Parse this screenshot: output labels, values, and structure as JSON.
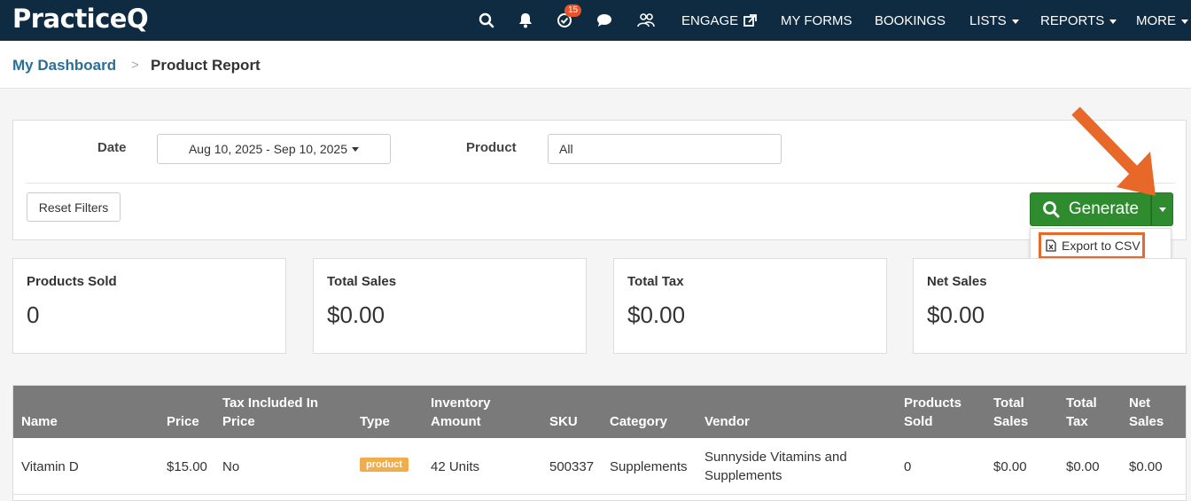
{
  "nav": {
    "logo": "PracticeQ",
    "badge_count": "15",
    "links": [
      "ENGAGE",
      "MY FORMS",
      "BOOKINGS",
      "LISTS",
      "REPORTS",
      "MORE"
    ]
  },
  "breadcrumb": {
    "home": "My Dashboard",
    "separator": ">",
    "current": "Product Report"
  },
  "filters": {
    "date_label": "Date",
    "date_value": "Aug 10, 2025 - Sep 10, 2025",
    "product_label": "Product",
    "product_value": "All",
    "reset_label": "Reset Filters",
    "generate_label": "Generate",
    "export_label": "Export to CSV"
  },
  "cards": [
    {
      "label": "Products Sold",
      "value": "0"
    },
    {
      "label": "Total Sales",
      "value": "$0.00"
    },
    {
      "label": "Total Tax",
      "value": "$0.00"
    },
    {
      "label": "Net Sales",
      "value": "$0.00"
    }
  ],
  "table": {
    "headers": {
      "name": "Name",
      "price": "Price",
      "tax_included_1": "Tax Included In",
      "tax_included_2": "Price",
      "type": "Type",
      "inventory_1": "Inventory",
      "inventory_2": "Amount",
      "sku": "SKU",
      "category": "Category",
      "vendor": "Vendor",
      "products_sold_1": "Products",
      "products_sold_2": "Sold",
      "total_sales_1": "Total",
      "total_sales_2": "Sales",
      "total_tax_1": "Total",
      "total_tax_2": "Tax",
      "net_sales_1": "Net",
      "net_sales_2": "Sales"
    },
    "rows": [
      {
        "name": "Vitamin D",
        "price": "$15.00",
        "tax_included": "No",
        "type": "product",
        "inventory": "42 Units",
        "sku": "500337",
        "category": "Supplements",
        "vendor_1": "Sunnyside Vitamins and",
        "vendor_2": "Supplements",
        "products_sold": "0",
        "total_sales": "$0.00",
        "total_tax": "$0.00",
        "net_sales": "$0.00"
      }
    ]
  },
  "colors": {
    "nav_bg": "#0f2b42",
    "generate": "#2e8b2e",
    "annotation": "#e8682a",
    "tag": "#f0ad4e"
  }
}
